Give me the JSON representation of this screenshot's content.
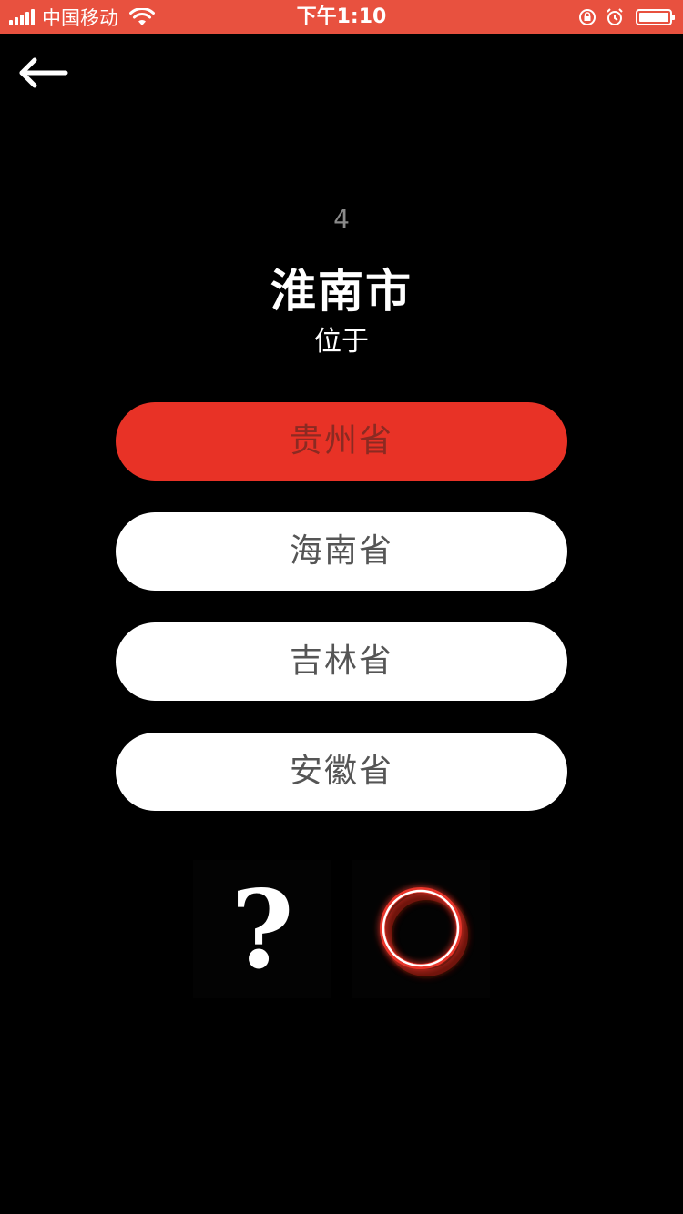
{
  "status_bar": {
    "carrier": "中国移动",
    "time": "下午1:10",
    "icons": [
      "signal-icon",
      "wifi-icon",
      "rotation-lock-icon",
      "alarm-icon",
      "battery-icon"
    ],
    "background_color": "#e8513f"
  },
  "nav": {
    "back_icon": "left-arrow-icon"
  },
  "question": {
    "number": "4",
    "title": "淮南市",
    "subtitle": "位于"
  },
  "options": [
    {
      "label": "贵州省",
      "selected": true
    },
    {
      "label": "海南省",
      "selected": false
    },
    {
      "label": "吉林省",
      "selected": false
    },
    {
      "label": "安徽省",
      "selected": false
    }
  ],
  "controls": {
    "hint_label": "?",
    "record_icon": "glowing-circle-icon"
  },
  "colors": {
    "selected_option": "#e83226",
    "option_default": "#ffffff",
    "background": "#000000"
  }
}
